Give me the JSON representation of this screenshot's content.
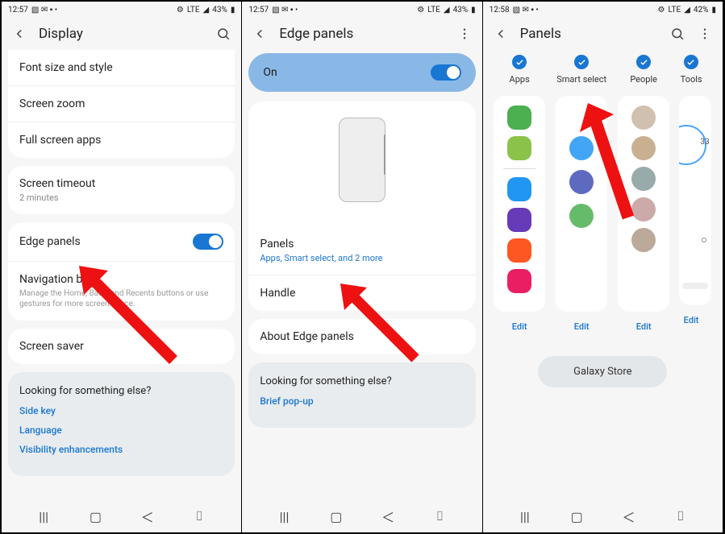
{
  "panel1": {
    "status": {
      "time": "12:57",
      "battery": "43%",
      "net": "LTE"
    },
    "title": "Display",
    "groups": [
      {
        "rows": [
          {
            "label": "Font size and style"
          },
          {
            "label": "Screen zoom"
          },
          {
            "label": "Full screen apps"
          }
        ]
      },
      {
        "rows": [
          {
            "label": "Screen timeout",
            "sub": "2 minutes",
            "sub_gray": true
          }
        ]
      },
      {
        "rows": [
          {
            "label": "Edge panels",
            "toggle": true
          },
          {
            "label": "Navigation bar",
            "desc": "Manage the Home, Back, and Recents buttons or use gestures for more screen space."
          }
        ]
      },
      {
        "rows": [
          {
            "label": "Screen saver"
          }
        ]
      }
    ],
    "footer": {
      "title": "Looking for something else?",
      "links": [
        "Side key",
        "Language",
        "Visibility enhancements"
      ]
    }
  },
  "panel2": {
    "status": {
      "time": "12:57",
      "battery": "43%",
      "net": "LTE"
    },
    "title": "Edge panels",
    "toggle_label": "On",
    "rows": [
      {
        "label": "Panels",
        "sub": "Apps, Smart select, and 2 more"
      },
      {
        "label": "Handle"
      }
    ],
    "about_row": {
      "label": "About Edge panels"
    },
    "footer": {
      "title": "Looking for something else?",
      "links": [
        "Brief pop-up"
      ]
    }
  },
  "panel3": {
    "status": {
      "time": "12:58",
      "battery": "42%",
      "net": "LTE"
    },
    "title": "Panels",
    "columns": [
      {
        "name": "Apps",
        "edit": "Edit",
        "icons": [
          {
            "bg": "#4caf50"
          },
          {
            "bg": "#8bc34a"
          },
          {
            "bg": "#2196f3"
          },
          {
            "bg": "#673ab7"
          },
          {
            "bg": "#ff5722"
          },
          {
            "bg": "#e91e63"
          }
        ],
        "divider_after": 1
      },
      {
        "name": "Smart select",
        "edit": "Edit",
        "icons": [
          {
            "bg": "#42a5f5",
            "circle": true
          },
          {
            "bg": "#5c6bc0",
            "circle": true
          },
          {
            "bg": "#66bb6a",
            "circle": true
          }
        ],
        "offset": true
      },
      {
        "name": "People",
        "edit": "Edit",
        "avatars": 5
      },
      {
        "name": "Tools",
        "edit": "Edit",
        "weather": true,
        "temp": "33"
      }
    ],
    "store_btn": "Galaxy Store"
  }
}
